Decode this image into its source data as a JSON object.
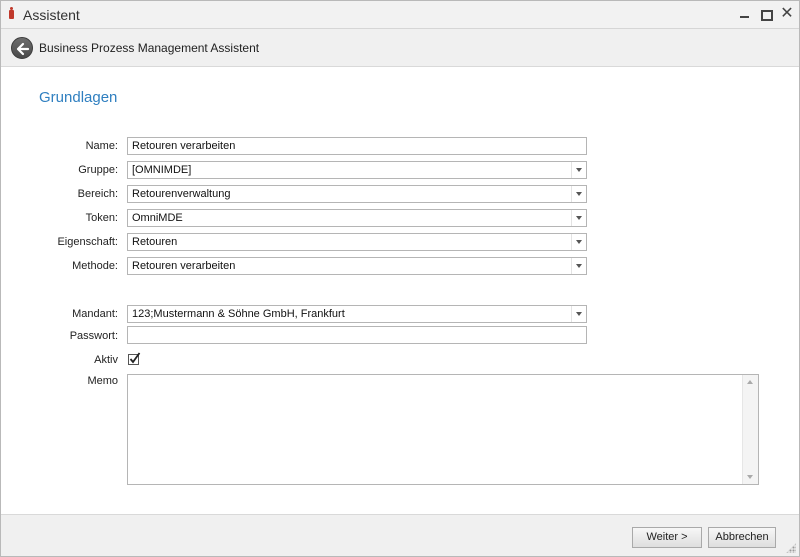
{
  "window": {
    "title": "Assistent"
  },
  "header": {
    "title": "Business Prozess Management Assistent"
  },
  "section": {
    "title": "Grundlagen"
  },
  "form": {
    "name": {
      "label": "Name:",
      "value": "Retouren verarbeiten"
    },
    "gruppe": {
      "label": "Gruppe:",
      "value": "[OMNIMDE]"
    },
    "bereich": {
      "label": "Bereich:",
      "value": "Retourenverwaltung"
    },
    "token": {
      "label": "Token:",
      "value": "OmniMDE"
    },
    "eigenschaft": {
      "label": "Eigenschaft:",
      "value": "Retouren"
    },
    "methode": {
      "label": "Methode:",
      "value": "Retouren verarbeiten"
    },
    "mandant": {
      "label": "Mandant:",
      "value": "123;Mustermann & Söhne GmbH, Frankfurt"
    },
    "passwort": {
      "label": "Passwort:",
      "value": ""
    },
    "aktiv": {
      "label": "Aktiv",
      "checked": true
    },
    "memo": {
      "label": "Memo",
      "value": ""
    }
  },
  "footer": {
    "next_label": "Weiter >",
    "cancel_label": "Abbrechen"
  },
  "colors": {
    "accent": "#2f7fc0",
    "app_icon": "#c0392b"
  },
  "icons": [
    "app-icon",
    "minimize-icon",
    "maximize-icon",
    "close-icon",
    "back-arrow-icon",
    "chevron-down-icon",
    "checkmark-icon",
    "resize-grip-icon"
  ]
}
